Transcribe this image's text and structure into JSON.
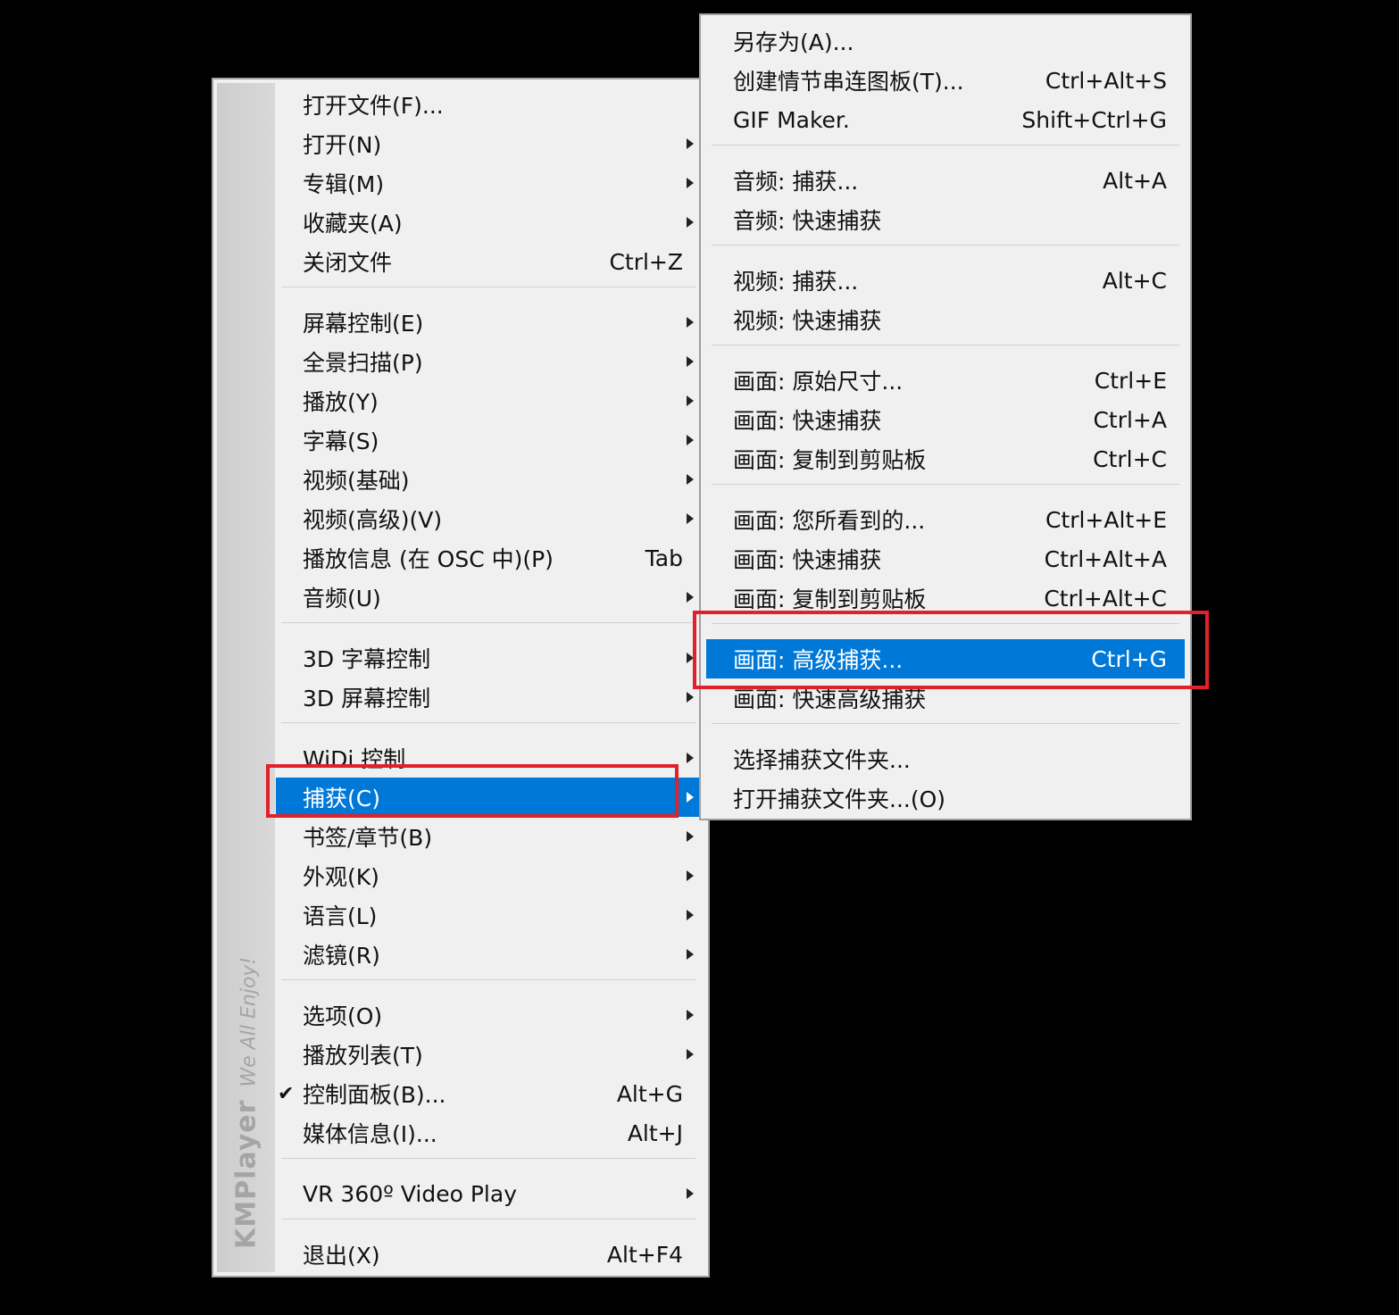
{
  "main_menu": {
    "brand": {
      "logo": "KMPlayer",
      "tagline": "We All Enjoy!"
    },
    "items": [
      {
        "label": "打开文件(F)...",
        "shortcut": "",
        "arrow": false
      },
      {
        "label": "打开(N)",
        "shortcut": "",
        "arrow": true
      },
      {
        "label": "专辑(M)",
        "shortcut": "",
        "arrow": true
      },
      {
        "label": "收藏夹(A)",
        "shortcut": "",
        "arrow": true
      },
      {
        "label": "关闭文件",
        "shortcut": "Ctrl+Z",
        "arrow": false
      },
      {
        "label": "屏幕控制(E)",
        "shortcut": "",
        "arrow": true
      },
      {
        "label": "全景扫描(P)",
        "shortcut": "",
        "arrow": true
      },
      {
        "label": "播放(Y)",
        "shortcut": "",
        "arrow": true
      },
      {
        "label": "字幕(S)",
        "shortcut": "",
        "arrow": true
      },
      {
        "label": "视频(基础)",
        "shortcut": "",
        "arrow": true
      },
      {
        "label": "视频(高级)(V)",
        "shortcut": "",
        "arrow": true
      },
      {
        "label": "播放信息 (在 OSC 中)(P)",
        "shortcut": "Tab",
        "arrow": false
      },
      {
        "label": "音频(U)",
        "shortcut": "",
        "arrow": true
      },
      {
        "label": "3D 字幕控制",
        "shortcut": "",
        "arrow": true
      },
      {
        "label": "3D 屏幕控制",
        "shortcut": "",
        "arrow": true
      },
      {
        "label": "WiDi 控制",
        "shortcut": "",
        "arrow": true
      },
      {
        "label": "捕获(C)",
        "shortcut": "",
        "arrow": true,
        "highlighted": true
      },
      {
        "label": "书签/章节(B)",
        "shortcut": "",
        "arrow": true
      },
      {
        "label": "外观(K)",
        "shortcut": "",
        "arrow": true
      },
      {
        "label": "语言(L)",
        "shortcut": "",
        "arrow": true
      },
      {
        "label": "滤镜(R)",
        "shortcut": "",
        "arrow": true
      },
      {
        "label": "选项(O)",
        "shortcut": "",
        "arrow": true
      },
      {
        "label": "播放列表(T)",
        "shortcut": "",
        "arrow": true
      },
      {
        "label": "控制面板(B)...",
        "shortcut": "Alt+G",
        "arrow": false,
        "checked": true
      },
      {
        "label": "媒体信息(I)...",
        "shortcut": "Alt+J",
        "arrow": false
      },
      {
        "label": "VR 360º Video Play",
        "shortcut": "",
        "arrow": true
      },
      {
        "label": "退出(X)",
        "shortcut": "Alt+F4",
        "arrow": false
      }
    ]
  },
  "capture_submenu": {
    "items": [
      {
        "label": "另存为(A)...",
        "shortcut": ""
      },
      {
        "label": "创建情节串连图板(T)...",
        "shortcut": "Ctrl+Alt+S"
      },
      {
        "label": "GIF Maker.",
        "shortcut": "Shift+Ctrl+G"
      },
      {
        "label": "音频: 捕获...",
        "shortcut": "Alt+A"
      },
      {
        "label": "音频: 快速捕获",
        "shortcut": ""
      },
      {
        "label": "视频: 捕获...",
        "shortcut": "Alt+C"
      },
      {
        "label": "视频: 快速捕获",
        "shortcut": ""
      },
      {
        "label": "画面: 原始尺寸...",
        "shortcut": "Ctrl+E"
      },
      {
        "label": "画面: 快速捕获",
        "shortcut": "Ctrl+A"
      },
      {
        "label": "画面: 复制到剪贴板",
        "shortcut": "Ctrl+C"
      },
      {
        "label": "画面: 您所看到的...",
        "shortcut": "Ctrl+Alt+E"
      },
      {
        "label": "画面: 快速捕获",
        "shortcut": "Ctrl+Alt+A"
      },
      {
        "label": "画面: 复制到剪贴板",
        "shortcut": "Ctrl+Alt+C"
      },
      {
        "label": "画面: 高级捕获...",
        "shortcut": "Ctrl+G",
        "highlighted": true
      },
      {
        "label": "画面: 快速高级捕获",
        "shortcut": ""
      },
      {
        "label": "选择捕获文件夹...",
        "shortcut": ""
      },
      {
        "label": "打开捕获文件夹...(O)",
        "shortcut": ""
      }
    ]
  },
  "colors": {
    "highlight": "#0078d7",
    "annotation_box": "#e0202a",
    "menu_bg": "#f0f0f0"
  }
}
